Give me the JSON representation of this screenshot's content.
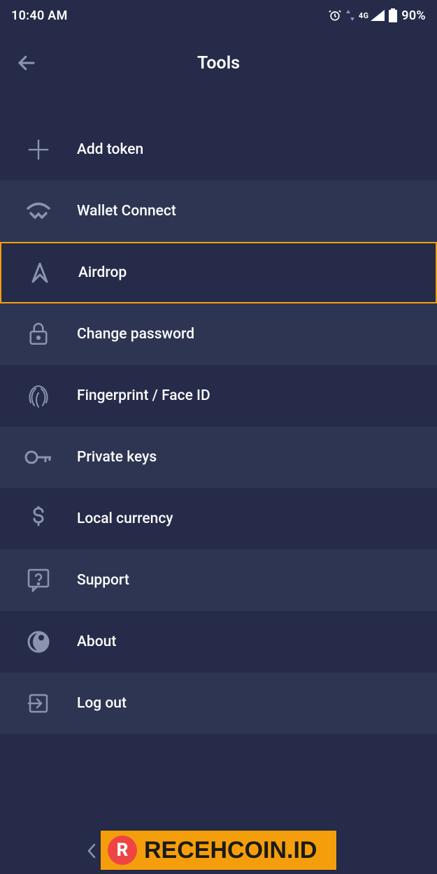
{
  "status": {
    "time": "10:40 AM",
    "battery": "90%",
    "network": "4G"
  },
  "header": {
    "title": "Tools"
  },
  "menu": {
    "add_token": "Add token",
    "wallet_connect": "Wallet Connect",
    "airdrop": "Airdrop",
    "change_password": "Change password",
    "fingerprint": "Fingerprint / Face ID",
    "private_keys": "Private keys",
    "local_currency": "Local currency",
    "support": "Support",
    "about": "About",
    "log_out": "Log out"
  },
  "banner": {
    "logo_letter": "R",
    "text": "RECEHCOIN.ID"
  }
}
